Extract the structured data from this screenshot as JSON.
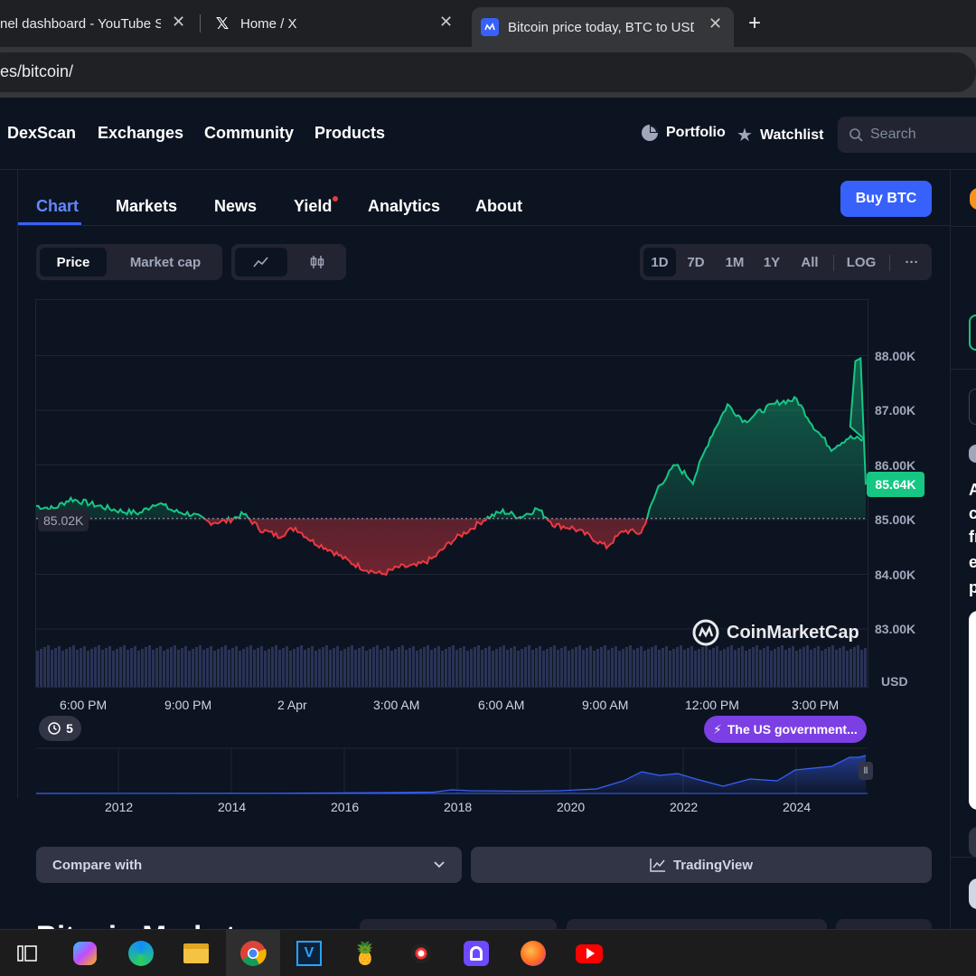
{
  "browser": {
    "tabs": [
      {
        "title": "nel dashboard - YouTube S"
      },
      {
        "title": "Home / X"
      },
      {
        "title": "Bitcoin price today, BTC to USD"
      }
    ],
    "url": "es/bitcoin/"
  },
  "header": {
    "nav": [
      "DexScan",
      "Exchanges",
      "Community",
      "Products"
    ],
    "portfolio": "Portfolio",
    "watchlist": "Watchlist",
    "search_placeholder": "Search"
  },
  "subnav": {
    "tabs": [
      "Chart",
      "Markets",
      "News",
      "Yield",
      "Analytics",
      "About"
    ],
    "active": "Chart",
    "buy_button": "Buy BTC"
  },
  "controls": {
    "metric_toggle": [
      "Price",
      "Market cap"
    ],
    "metric_selected": "Price",
    "ranges": [
      "1D",
      "7D",
      "1M",
      "1Y",
      "All",
      "LOG"
    ],
    "range_selected": "1D",
    "more": "···"
  },
  "chart_data": {
    "type": "area",
    "title": "",
    "xlabel": "",
    "ylabel": "USD",
    "ylim": [
      82500,
      88500
    ],
    "yticks": [
      "88.00K",
      "87.00K",
      "86.00K",
      "85.00K",
      "84.00K",
      "83.00K"
    ],
    "xticks": [
      "6:00 PM",
      "9:00 PM",
      "2 Apr",
      "3:00 AM",
      "6:00 AM",
      "9:00 AM",
      "12:00 PM",
      "3:00 PM"
    ],
    "baseline_label": "85.02K",
    "baseline": 85020,
    "current_label": "85.64K",
    "current": 85640,
    "colors": {
      "up": "#16c784",
      "down": "#ea3943",
      "volume": "#2a3356",
      "brush": "#3861fb"
    },
    "x_hours": [
      0,
      0.5,
      1,
      1.5,
      2,
      2.5,
      3,
      3.5,
      4,
      4.5,
      5,
      5.5,
      6,
      6.5,
      7,
      7.5,
      8,
      8.5,
      9,
      9.5,
      10,
      10.5,
      11,
      11.5,
      12,
      12.5,
      13,
      13.5,
      14,
      14.5,
      15,
      15.5,
      16,
      16.5,
      17,
      17.5,
      18,
      18.5,
      19,
      19.5,
      20,
      20.5,
      21,
      21.5,
      22,
      22.5,
      23,
      23.5,
      24
    ],
    "values": [
      85250,
      85200,
      85380,
      85300,
      85220,
      85150,
      85120,
      85320,
      85150,
      85100,
      84950,
      84970,
      85100,
      84820,
      84700,
      84850,
      84600,
      84450,
      84250,
      84100,
      84000,
      84130,
      84150,
      84300,
      84600,
      84800,
      85020,
      85150,
      85050,
      85200,
      84900,
      84850,
      84700,
      84500,
      84800,
      84750,
      85600,
      86000,
      85700,
      86500,
      87100,
      86800,
      87000,
      87150,
      87200,
      86700,
      86300,
      86500,
      86450
    ],
    "spike": {
      "x_hour": 23.7,
      "value": 87900
    },
    "minimap": {
      "xticks": [
        "2012",
        "2014",
        "2016",
        "2018",
        "2020",
        "2022",
        "2024"
      ]
    }
  },
  "chart_overlays": {
    "watermark": "CoinMarketCap",
    "history_count": "5",
    "news_badge": "The US government..."
  },
  "actions": {
    "compare": "Compare with",
    "tradingview": "TradingView"
  },
  "below": {
    "section_title": "Bitcoin Markets"
  },
  "right_sidebar_letters": [
    "A",
    "c",
    "fr",
    "e",
    "p"
  ],
  "taskbar": {
    "apps": [
      "task-view",
      "copilot",
      "edge",
      "file-explorer",
      "chrome",
      "vim-app",
      "pinata-app",
      "media-app",
      "proton-app",
      "firefox",
      "youtube"
    ]
  }
}
